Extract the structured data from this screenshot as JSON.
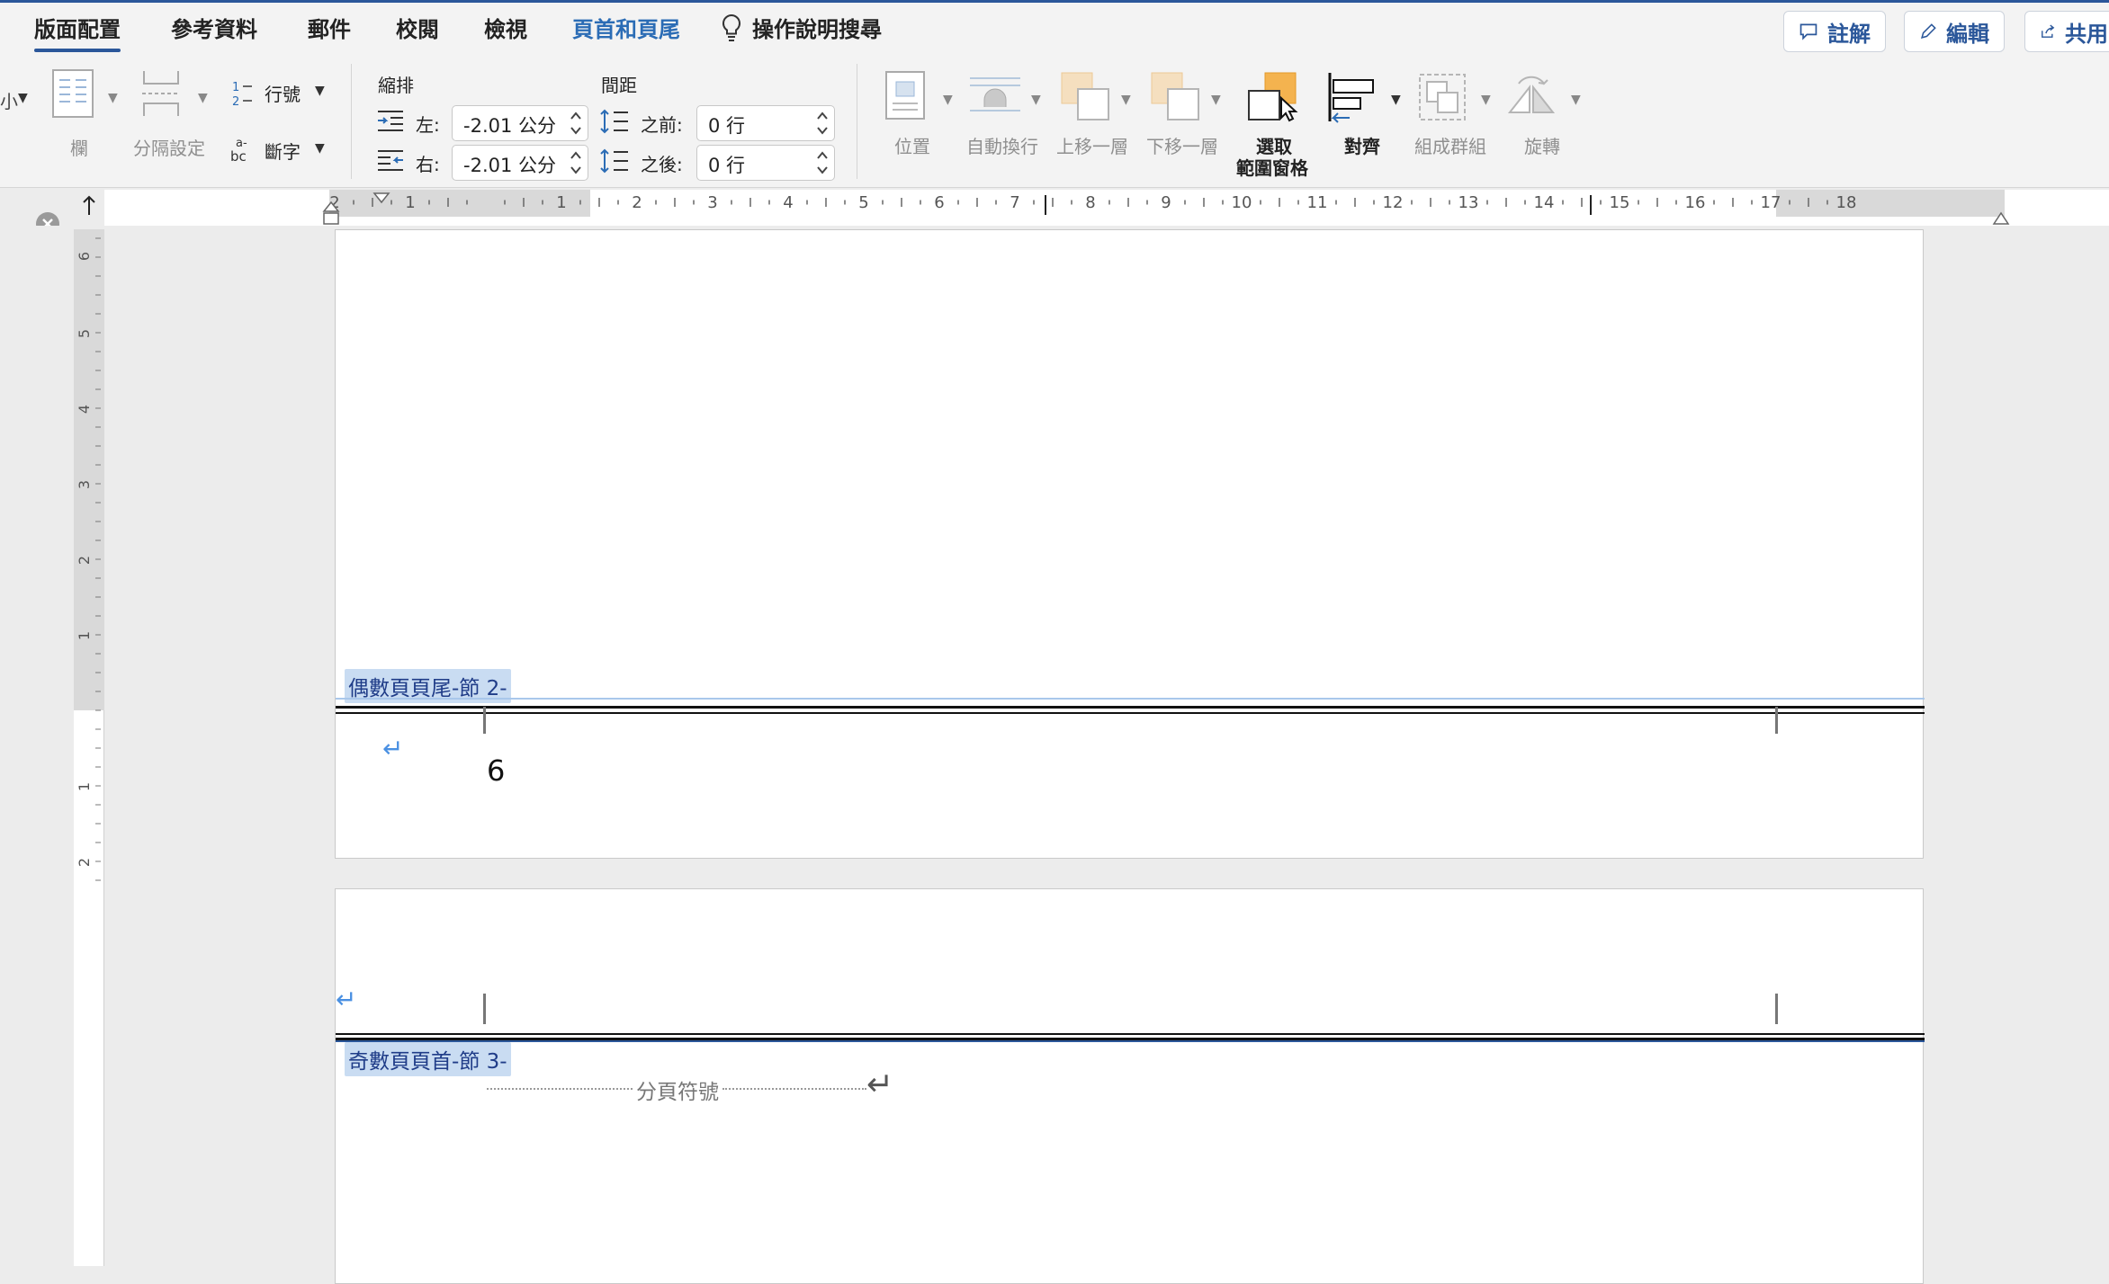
{
  "tabs": [
    {
      "label": "版面配置",
      "active": true
    },
    {
      "label": "參考資料"
    },
    {
      "label": "郵件"
    },
    {
      "label": "校閱"
    },
    {
      "label": "檢視"
    },
    {
      "label": "頁首和頁尾",
      "contextual": true
    }
  ],
  "tellme": {
    "label": "操作說明搜尋",
    "icon": "lightbulb-icon"
  },
  "top_buttons": {
    "comments": "註解",
    "edit": "編輯",
    "share": "共用"
  },
  "ribbon": {
    "size_label_fragment": "小",
    "columns": "欄",
    "breaks": "分隔設定",
    "line_numbers": "行號",
    "hyphenation": "斷字",
    "indent": {
      "title": "縮排",
      "left_label": "左:",
      "left_value": "-2.01 公分",
      "right_label": "右:",
      "right_value": "-2.01 公分"
    },
    "spacing": {
      "title": "間距",
      "before_label": "之前:",
      "before_value": "0 行",
      "after_label": "之後:",
      "after_value": "0 行"
    },
    "arrange": {
      "position": "位置",
      "wrap_text": "自動換行",
      "bring_forward": "上移一層",
      "send_backward": "下移一層",
      "selection_pane_line1": "選取",
      "selection_pane_line2": "範圍窗格",
      "align": "對齊",
      "group": "組成群組",
      "rotate": "旋轉"
    }
  },
  "ruler_h_labels": [
    "2",
    "1",
    "1",
    "2",
    "3",
    "4",
    "5",
    "6",
    "7",
    "8",
    "9",
    "10",
    "11",
    "12",
    "13",
    "14",
    "15",
    "16",
    "17",
    "18"
  ],
  "ruler_v_labels": [
    "6",
    "5",
    "4",
    "3",
    "2",
    "1",
    "1",
    "2"
  ],
  "document": {
    "footer_tag": "偶數頁頁尾-節 2-",
    "page_number": "6",
    "header_tag": "奇數頁頁首-節 3-",
    "page_break_label": "分頁符號",
    "return_symbol": "↵"
  },
  "colors": {
    "accent": "#2b579a",
    "tag_bg": "#c9dcf2",
    "tag_text": "#1f3c88",
    "return_mark": "#4a90e2"
  }
}
